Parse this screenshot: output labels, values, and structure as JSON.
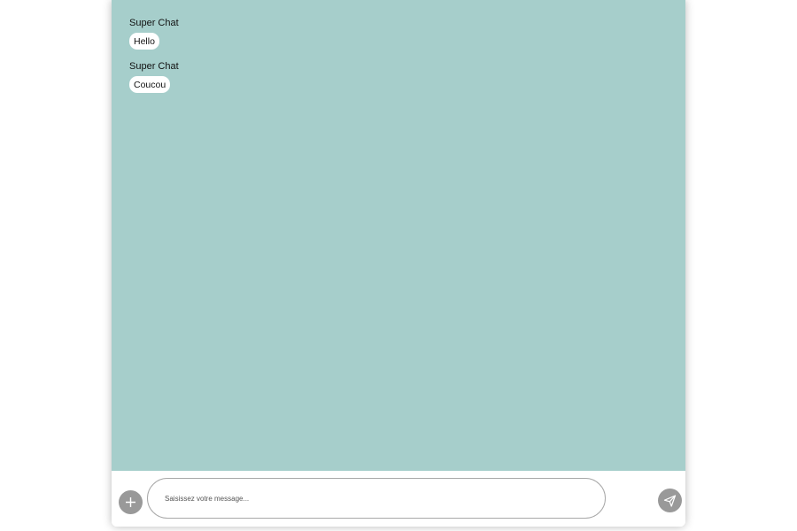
{
  "chat": {
    "messages": [
      {
        "sender": "Super Chat",
        "text": "Hello"
      },
      {
        "sender": "Super Chat",
        "text": "Coucou"
      }
    ],
    "background_color": "#a6cecb"
  },
  "composer": {
    "placeholder": "Saisissez votre message...",
    "value": "",
    "add_icon": "plus-icon",
    "send_icon": "send-icon",
    "button_color": "#999999"
  }
}
